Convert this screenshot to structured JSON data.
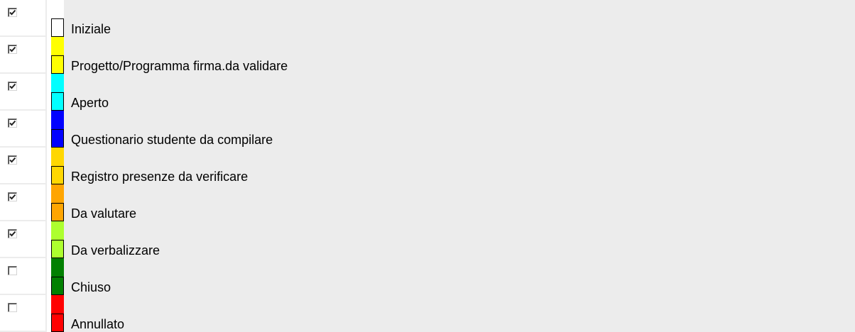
{
  "statuses": [
    {
      "label": "Iniziale",
      "color": "#ffffff",
      "checked": true
    },
    {
      "label": "Progetto/Programma firma.da validare",
      "color": "#ffff00",
      "checked": true
    },
    {
      "label": "Aperto",
      "color": "#00ffff",
      "checked": true
    },
    {
      "label": "Questionario studente da compilare",
      "color": "#0000ff",
      "checked": true
    },
    {
      "label": "Registro presenze da verificare",
      "color": "#ffd700",
      "checked": true
    },
    {
      "label": "Da valutare",
      "color": "#ffa500",
      "checked": true
    },
    {
      "label": "Da verbalizzare",
      "color": "#adff2f",
      "checked": true
    },
    {
      "label": "Chiuso",
      "color": "#008000",
      "checked": false
    },
    {
      "label": "Annullato",
      "color": "#ff0000",
      "checked": false
    }
  ],
  "icons": {
    "checkmark": "check-icon"
  }
}
